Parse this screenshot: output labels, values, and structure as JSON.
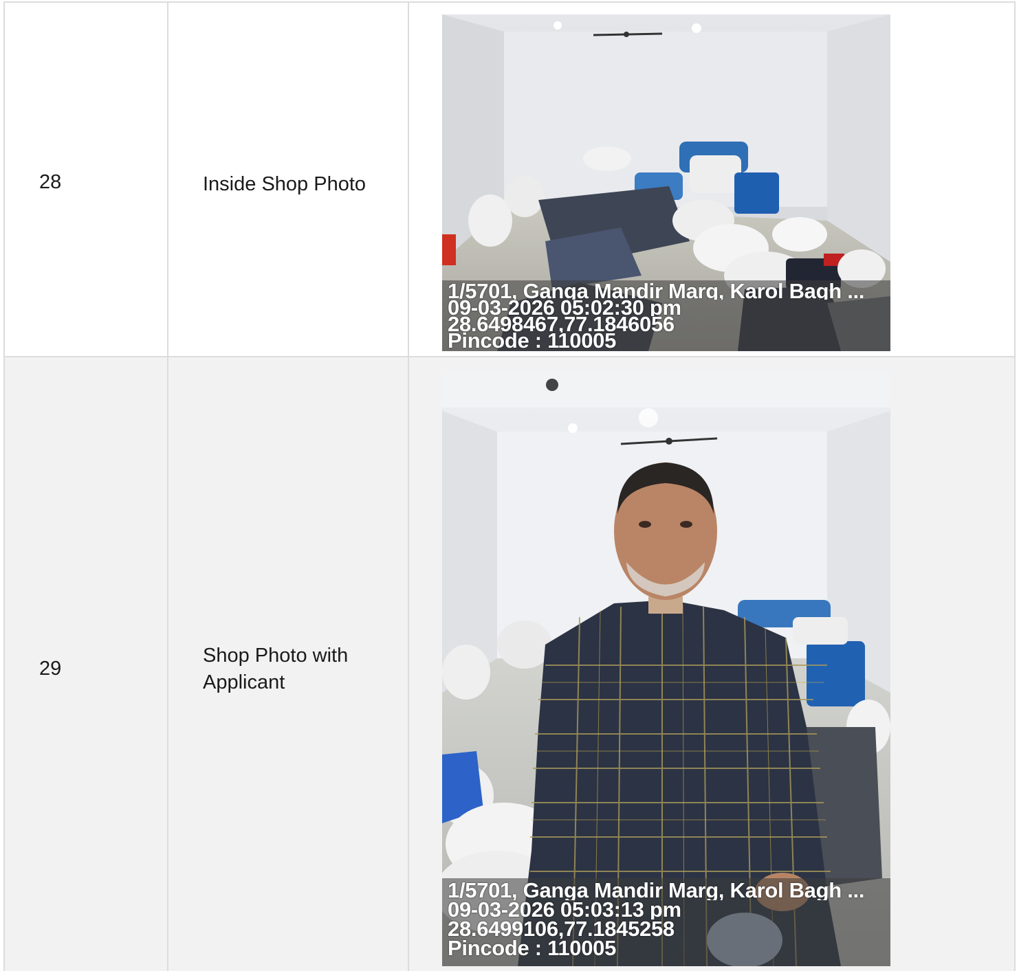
{
  "rows": [
    {
      "number": "28",
      "label": "Inside Shop Photo",
      "photo": {
        "address": "1/5701, Ganga Mandir Marg, Karol Bagh ...",
        "datetime": "09-03-2026 05:02:30 pm",
        "coords": "28.6498467,77.1846056",
        "pincode": "Pincode : 110005"
      }
    },
    {
      "number": "29",
      "label": "Shop Photo with Applicant",
      "photo": {
        "address": "1/5701, Ganga Mandir Marg, Karol Bagh ...",
        "datetime": "09-03-2026 05:03:13 pm",
        "coords": "28.6499106,77.1845258",
        "pincode": "Pincode : 110005"
      }
    }
  ]
}
